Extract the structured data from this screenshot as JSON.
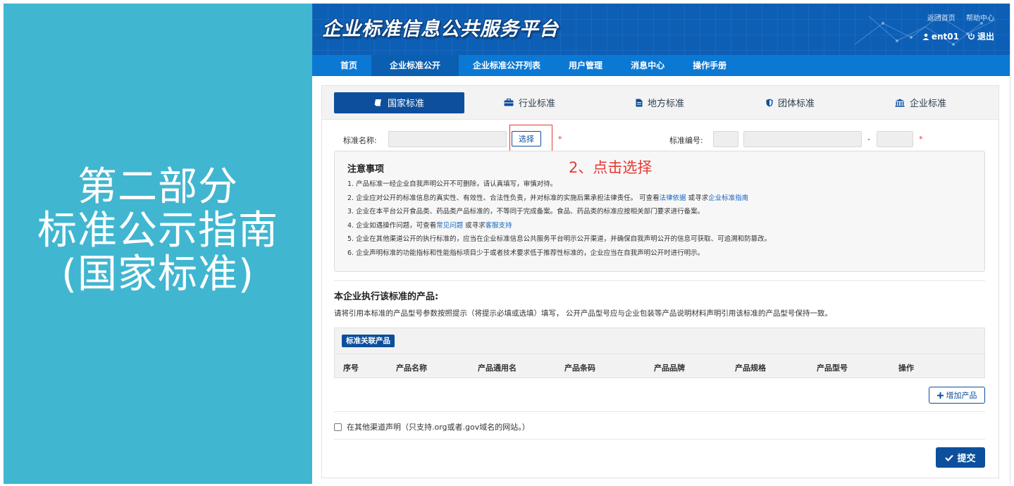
{
  "slide": {
    "title_lines": [
      "第二部分",
      "标准公示指南",
      "(国家标准)"
    ]
  },
  "header": {
    "brand": "企业标准信息公共服务平台",
    "top_links": [
      "返回首页",
      "帮助中心"
    ],
    "username": "ent01",
    "logout": "退出"
  },
  "nav": {
    "items": [
      "首页",
      "企业标准公开",
      "企业标准公开列表",
      "用户管理",
      "消息中心",
      "操作手册"
    ],
    "active_index": 1
  },
  "tabs": [
    "国家标准",
    "行业标准",
    "地方标准",
    "团体标准",
    "企业标准"
  ],
  "form": {
    "standard_name_label": "标准名称:",
    "select_button": "选择",
    "required_mark": "*",
    "standard_code_label": "标准编号:",
    "code_separator": "-"
  },
  "annotation": "2、点击选择",
  "notice": {
    "title": "注意事项",
    "line1": "1. 产品标准一经企业自我声明公开不可删除，请认真填写，审慎对待。",
    "line2_a": "2. 企业应对公开的标准信息的真实性、有效性、合法性负责，并对标准的实施后果承担法律责任。 可查看",
    "line2_link1": "法律依据",
    "line2_b": " 或寻求",
    "line2_link2": "企业标准指南",
    "line3": "3. 企业在本平台公开食品类、药品类产品标准的，不等同于完成备案。食品、药品类的标准应按相关部门要求进行备案。",
    "line4_a": "4. 企业如遇操作问题，可查看",
    "line4_link1": "常见问题",
    "line4_b": " 或寻求",
    "line4_link2": "客服支持",
    "line5": "5. 企业在其他渠道公开的执行标准的，应当在企业标准信息公共服务平台明示公开渠道，并确保自我声明公开的信息可获取、可追溯和防篡改。",
    "line6": "6. 企业声明标准的功能指标和性能指标项目少于或者技术要求低于推荐性标准的，企业应当在自我声明公开时进行明示。"
  },
  "products": {
    "section_title": "本企业执行该标准的产品:",
    "description": "请将引用本标准的产品型号参数按照提示（将提示必填或选填）填写， 公开产品型号应与企业包装等产品说明材料声明引用该标准的产品型号保持一致。",
    "badge": "标准关联产品",
    "columns": [
      "序号",
      "产品名称",
      "产品通用名",
      "产品条码",
      "产品品牌",
      "产品规格",
      "产品型号",
      "操作"
    ],
    "add_button": "增加产品"
  },
  "other_channel": "在其他渠道声明（只支持.org或者.gov域名的网站。）",
  "submit": "提交",
  "colors": {
    "slide_bg": "#41b6d0",
    "header_bg": "#0d5fb6",
    "nav_bg": "#0b78d4",
    "primary": "#0d4f9c",
    "annotation": "#e53935"
  }
}
